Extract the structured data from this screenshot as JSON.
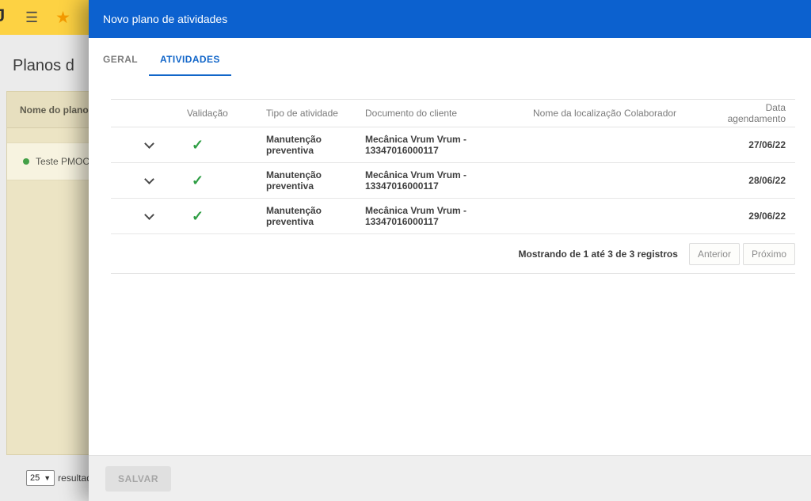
{
  "colors": {
    "primary_blue": "#0c61cf",
    "tab_active_blue": "#1266c9",
    "topbar_yellow": "#fdd243",
    "star_orange": "#f59b00",
    "check_green": "#2e9e44",
    "row_dot_green": "#43a047"
  },
  "topbar": {
    "logo": "J"
  },
  "page": {
    "title": "Planos d",
    "panel": {
      "header": "Nome do plano",
      "row_label": "Teste PMOC"
    },
    "page_size": {
      "value": "25",
      "suffix": "resultado"
    }
  },
  "modal": {
    "title": "Novo plano de atividades",
    "tabs": {
      "geral": "GERAL",
      "atividades": "ATIVIDADES"
    },
    "table": {
      "columns": {
        "validacao": "Validação",
        "tipo": "Tipo de atividade",
        "documento": "Documento do cliente",
        "localizacao": "Nome da localização",
        "colaborador": "Colaborador",
        "data": "Data agendamento"
      },
      "rows": [
        {
          "tipo": "Manutenção preventiva",
          "documento": "Mecânica Vrum Vrum - 13347016000117",
          "localizacao": "",
          "colaborador": "",
          "data": "27/06/22"
        },
        {
          "tipo": "Manutenção preventiva",
          "documento": "Mecânica Vrum Vrum - 13347016000117",
          "localizacao": "",
          "colaborador": "",
          "data": "28/06/22"
        },
        {
          "tipo": "Manutenção preventiva",
          "documento": "Mecânica Vrum Vrum - 13347016000117",
          "localizacao": "",
          "colaborador": "",
          "data": "29/06/22"
        }
      ],
      "footer": {
        "summary": "Mostrando de 1 até 3 de 3 registros",
        "prev_label": "Anterior",
        "next_label": "Próximo"
      }
    },
    "save_label": "SALVAR"
  }
}
